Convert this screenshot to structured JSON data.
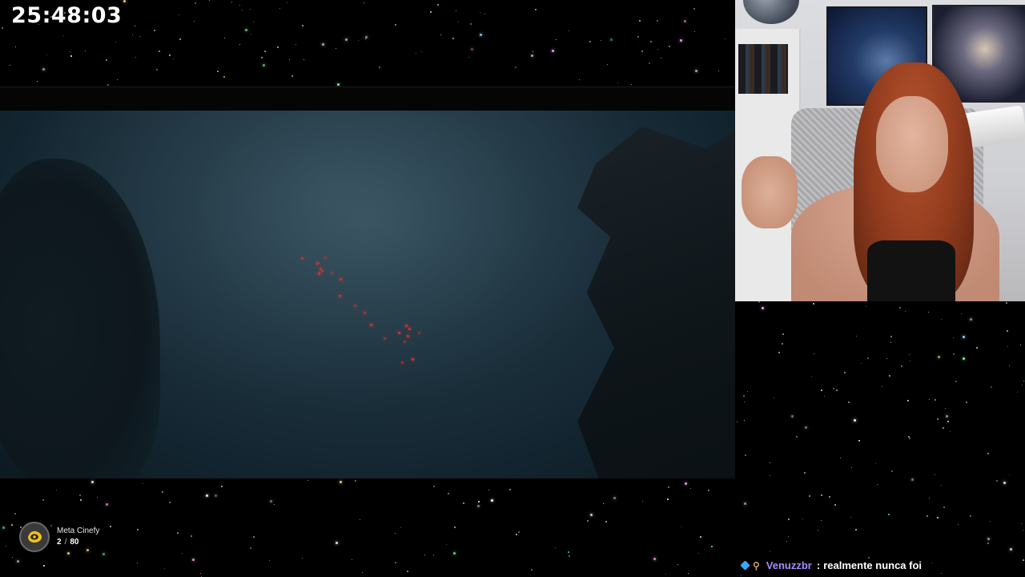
{
  "stream_timer": "25:48:03",
  "goal_widget": {
    "title": "Meta Cinefy",
    "current": "2",
    "separator": "/",
    "target": "80",
    "icon": "cinefy-eye-icon"
  },
  "chat_message": {
    "badges": [
      "cube-badge-icon",
      "deer-badge-icon"
    ],
    "username": "Venuzzbr",
    "separator": ":",
    "text": "realmente nunca foi",
    "username_color": "#a58cff"
  },
  "scene": {
    "video_panel": "movie-scene",
    "webcam_panel": "streamer-webcam",
    "background": "starfield"
  }
}
